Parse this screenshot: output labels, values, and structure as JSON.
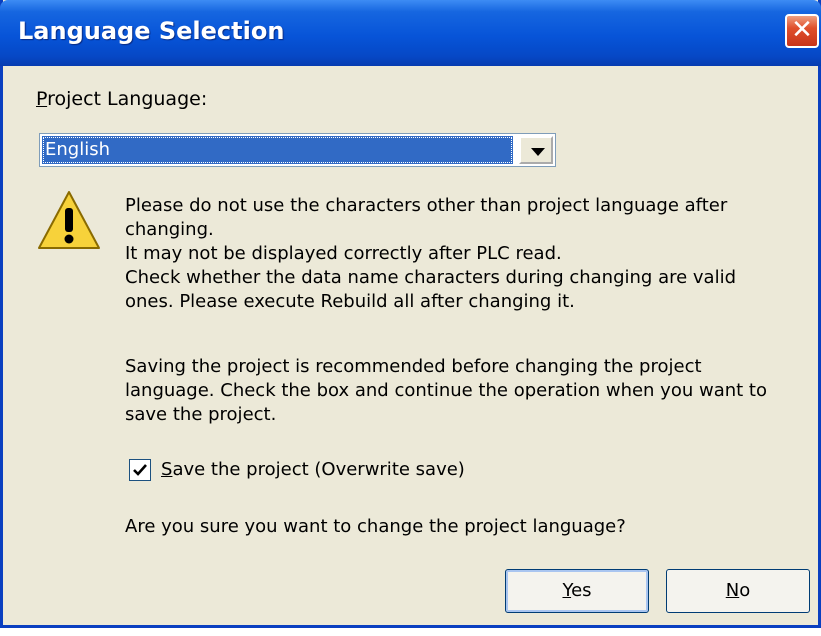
{
  "dialog": {
    "title": "Language Selection",
    "close_symbol": "✕",
    "project_language_label_hotkey": "P",
    "project_language_label_rest": "roject Language:",
    "language_select": {
      "selected": "English"
    },
    "warning_lines": [
      "Please do not use the characters other than project language after",
      "changing.",
      "It may not be displayed correctly after PLC read.",
      "Check whether the data name characters during changing are valid",
      "ones. Please execute Rebuild all after changing it."
    ],
    "save_note_lines": [
      "Saving the project is recommended before changing the project",
      "language. Check the box and continue the operation when you want to",
      "save the project."
    ],
    "save_checkbox": {
      "checked": true,
      "label_hotkey": "S",
      "label_rest": "ave the project (Overwrite save)"
    },
    "question": "Are you sure you want to change the project language?",
    "yes_button": {
      "hotkey": "Y",
      "rest": "es"
    },
    "no_button": {
      "hotkey": "N",
      "rest": "o"
    }
  },
  "icons": {
    "warning": "warning-icon",
    "close": "close-icon",
    "dropdown": "chevron-down-icon",
    "check": "check-icon"
  },
  "colors": {
    "titlebar": "#0754d8",
    "selection": "#316ac5",
    "window_bg": "#ece9d8",
    "close": "#e0502c",
    "warning_fill": "#f7d23a"
  }
}
